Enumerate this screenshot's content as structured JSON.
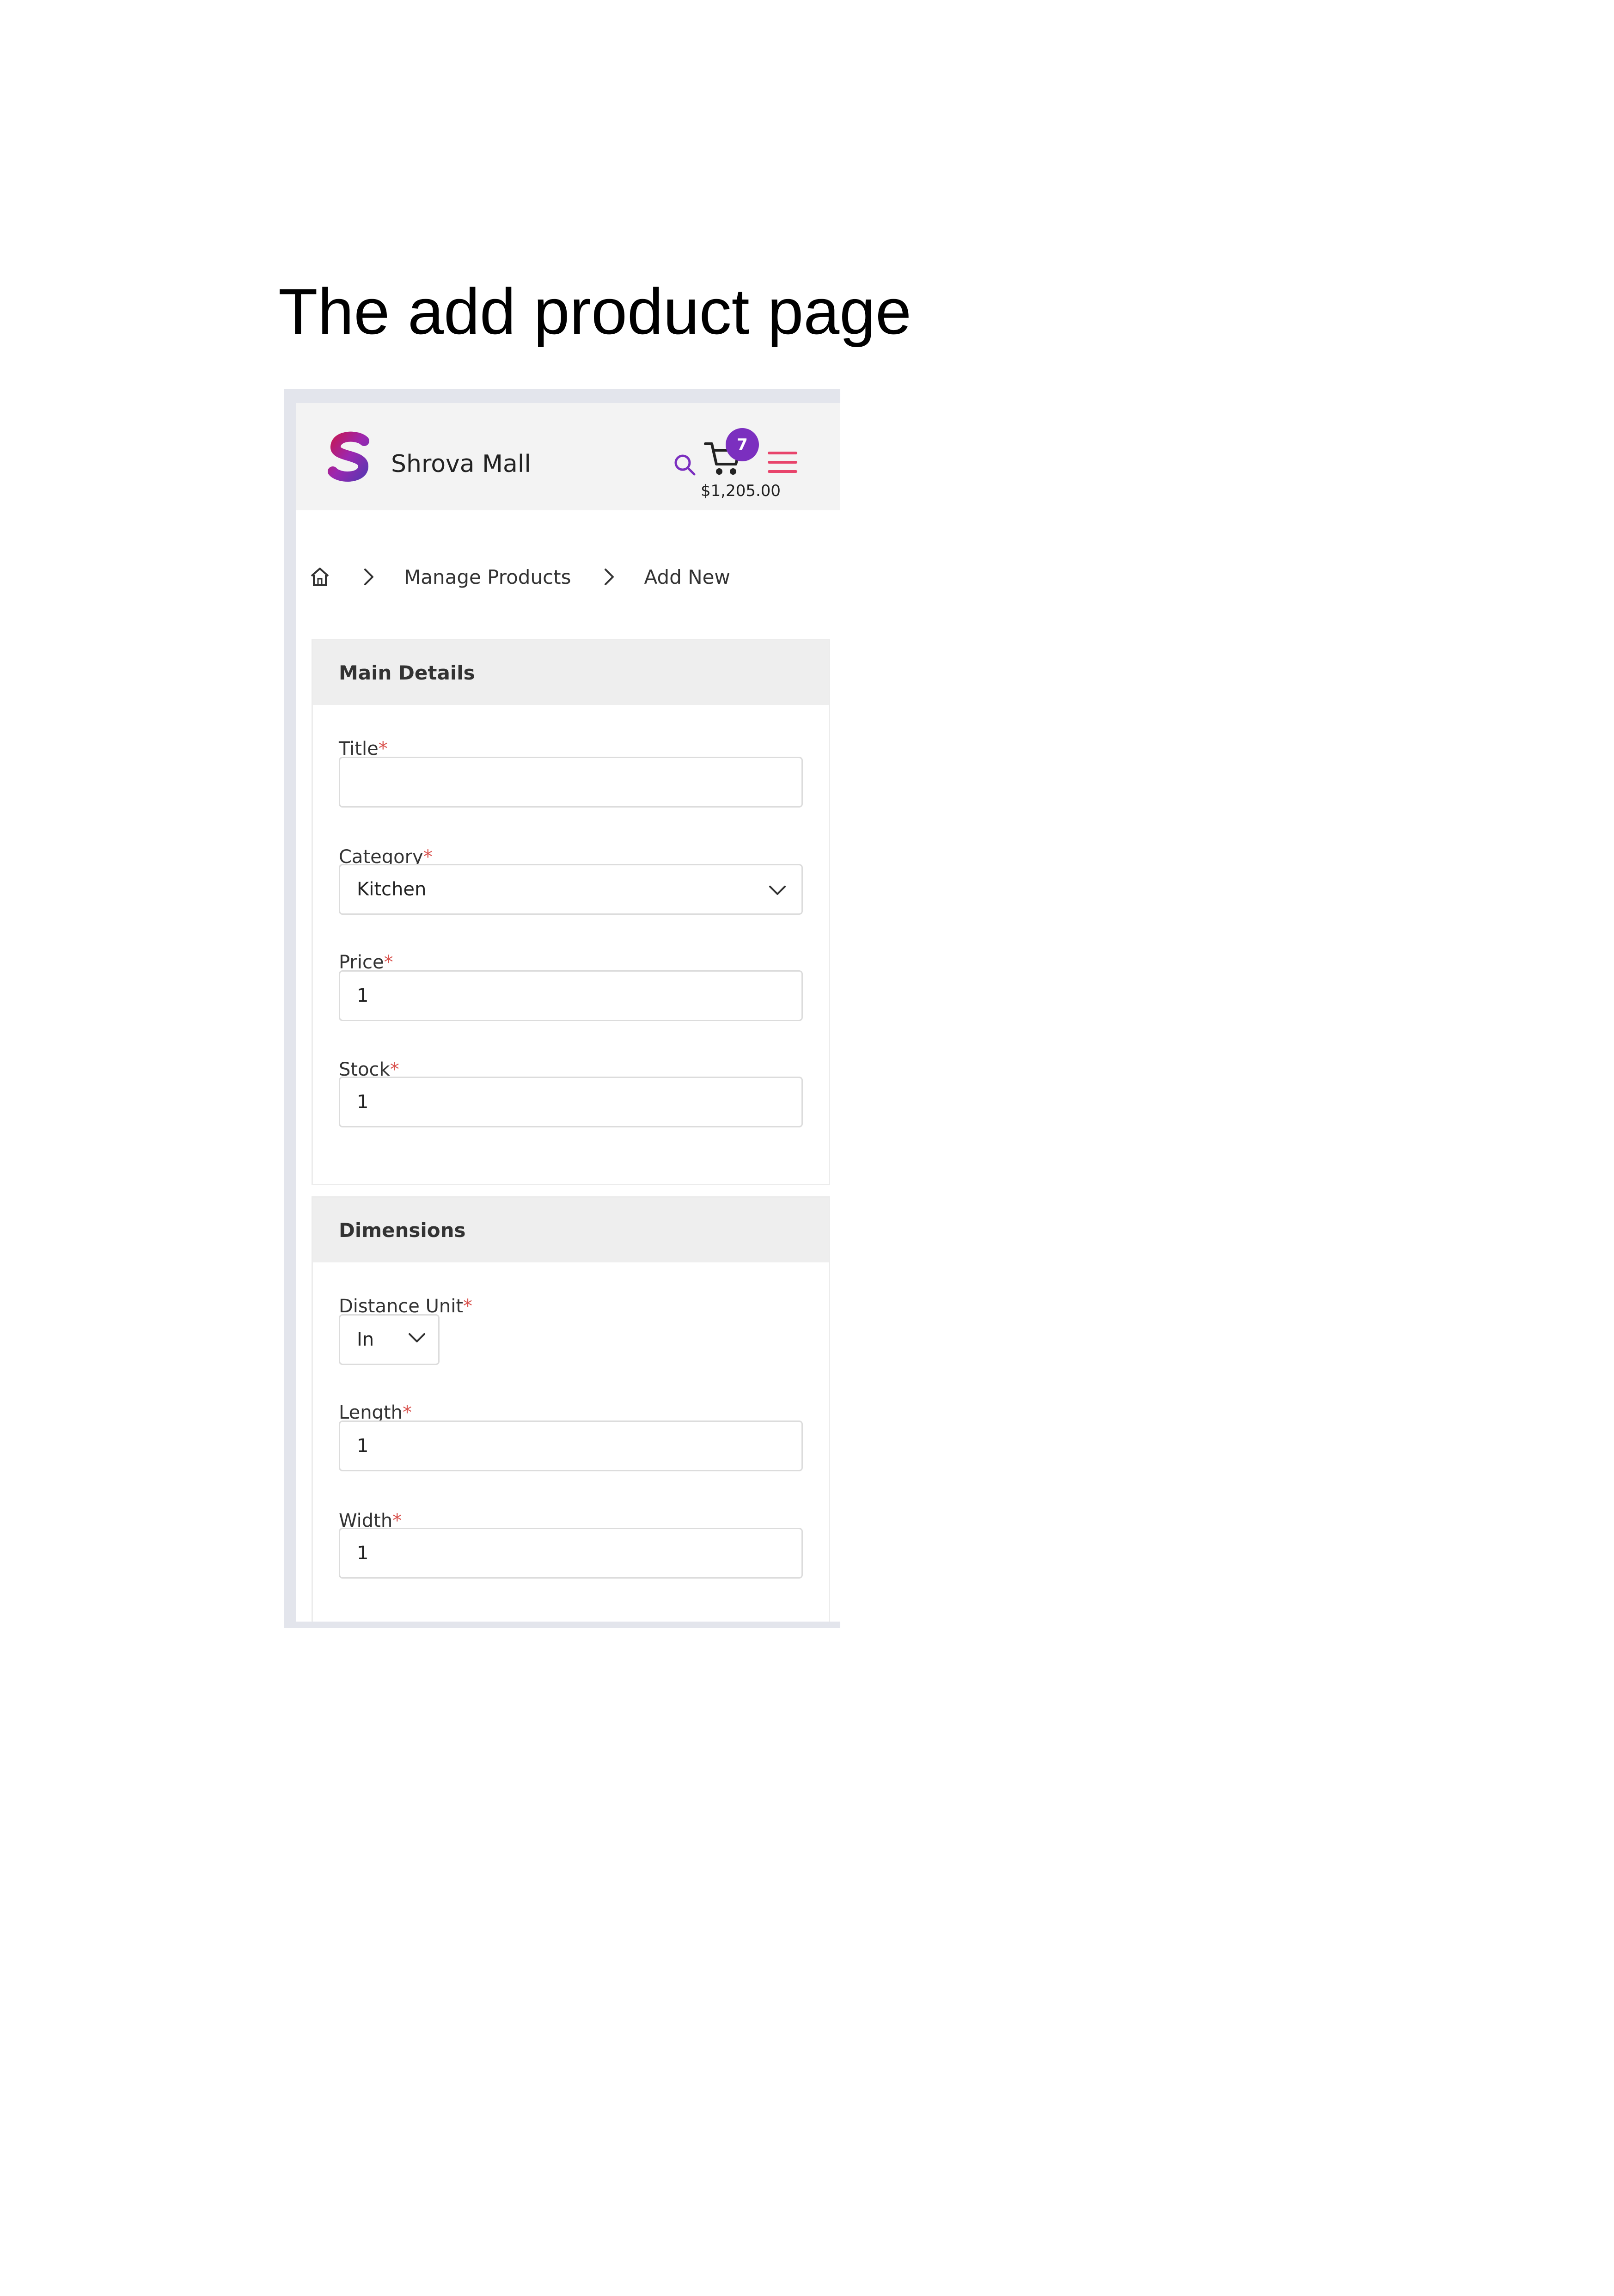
{
  "document": {
    "caption": "The add product page"
  },
  "header": {
    "brand": "Shrova Mall",
    "logo_letter": "S",
    "cart_count": "7",
    "cart_total": "$1,205.00",
    "accent_purple": "#7b2fbf",
    "accent_pink": "#e8446b"
  },
  "breadcrumb": {
    "items": [
      "Manage Products",
      "Add New"
    ],
    "icons": [
      "home-icon",
      "chevron-right-icon"
    ]
  },
  "main_details": {
    "heading": "Main Details",
    "title_label": "Title",
    "title_value": "",
    "category_label": "Category",
    "category_value": "Kitchen",
    "price_label": "Price",
    "price_value": "1",
    "stock_label": "Stock",
    "stock_value": "1",
    "required_mark": "*"
  },
  "dimensions": {
    "heading": "Dimensions",
    "unit_label": "Distance Unit",
    "unit_value": "In",
    "length_label": "Length",
    "length_value": "1",
    "width_label": "Width",
    "width_value": "1"
  }
}
